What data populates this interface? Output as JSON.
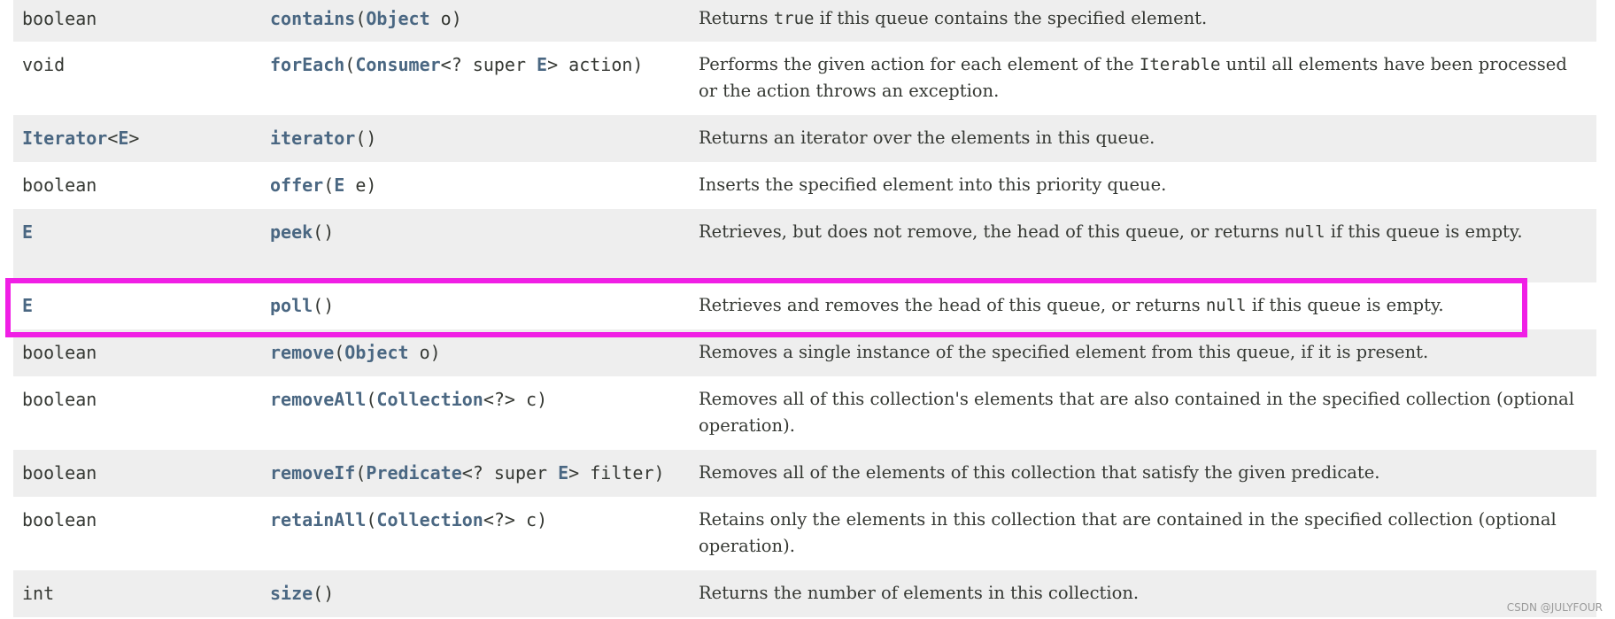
{
  "rows": [
    {
      "type": {
        "text": "boolean",
        "link": false
      },
      "method": {
        "name": "contains",
        "open": "(",
        "p1_type": "Object",
        "p1_rest": " o",
        "close": ")"
      },
      "desc": {
        "a": "Returns ",
        "code": "true",
        "b": " if this queue contains the specified element."
      }
    },
    {
      "type": {
        "text": "void",
        "link": false
      },
      "method": {
        "name": "forEach",
        "open": "(",
        "p1_type": "Consumer",
        "p1_mid": "<? super ",
        "p1_gen": "E",
        "p1_rest": "> action",
        "close": ")"
      },
      "desc": {
        "a": "Performs the given action for each element of the ",
        "code": "Iterable",
        "b": " until all elements have been processed or the action throws an exception."
      }
    },
    {
      "type": {
        "link_text": "Iterator",
        "suffix_open": "<",
        "gen": "E",
        "suffix_close": ">"
      },
      "method": {
        "name": "iterator",
        "args": "()"
      },
      "desc": {
        "text": "Returns an iterator over the elements in this queue."
      }
    },
    {
      "type": {
        "text": "boolean",
        "link": false
      },
      "method": {
        "name": "offer",
        "open": "(",
        "p1_type": "E",
        "p1_rest": " e",
        "close": ")"
      },
      "desc": {
        "text": "Inserts the specified element into this priority queue."
      }
    },
    {
      "type": {
        "link_text": "E"
      },
      "method": {
        "name": "peek",
        "args": "()"
      },
      "desc": {
        "a": "Retrieves, but does not remove, the head of this queue, or returns ",
        "code": "null",
        "b": " if this queue is empty."
      }
    },
    {
      "type": {
        "link_text": "E"
      },
      "method": {
        "name": "poll",
        "args": "()"
      },
      "desc": {
        "a": "Retrieves and removes the head of this queue, or returns ",
        "code": "null",
        "b": " if this queue is empty."
      }
    },
    {
      "type": {
        "text": "boolean",
        "link": false
      },
      "method": {
        "name": "remove",
        "open": "(",
        "p1_type": "Object",
        "p1_rest": " o",
        "close": ")"
      },
      "desc": {
        "text": "Removes a single instance of the specified element from this queue, if it is present."
      }
    },
    {
      "type": {
        "text": "boolean",
        "link": false
      },
      "method": {
        "name": "removeAll",
        "open": "(",
        "p1_type": "Collection",
        "p1_rest": "<?> c",
        "close": ")"
      },
      "desc": {
        "text": "Removes all of this collection's elements that are also contained in the specified collection (optional operation)."
      }
    },
    {
      "type": {
        "text": "boolean",
        "link": false
      },
      "method": {
        "name": "removeIf",
        "open": "(",
        "p1_type": "Predicate",
        "p1_mid": "<? super ",
        "p1_gen": "E",
        "p1_rest": "> filter",
        "close": ")"
      },
      "desc": {
        "text": "Removes all of the elements of this collection that satisfy the given predicate."
      }
    },
    {
      "type": {
        "text": "boolean",
        "link": false
      },
      "method": {
        "name": "retainAll",
        "open": "(",
        "p1_type": "Collection",
        "p1_rest": "<?> c",
        "close": ")"
      },
      "desc": {
        "text": "Retains only the elements in this collection that are contained in the specified collection (optional operation)."
      }
    },
    {
      "type": {
        "text": "int",
        "link": false
      },
      "method": {
        "name": "size",
        "args": "()"
      },
      "desc": {
        "text": "Returns the number of elements in this collection."
      }
    }
  ],
  "watermark": "CSDN @JULYFOUR",
  "colors": {
    "link": "#4a6782",
    "text": "#353833",
    "alt_row": "#eeeeee",
    "highlight": "#f01fe5"
  }
}
